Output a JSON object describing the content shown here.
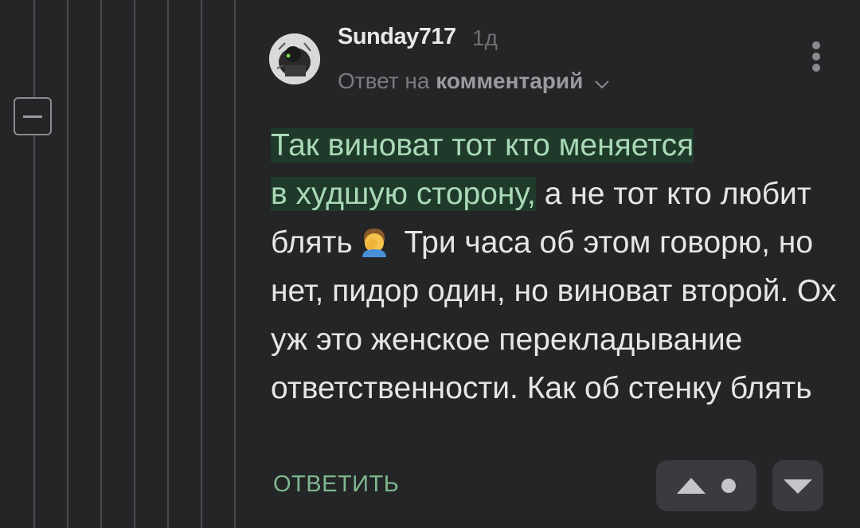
{
  "comment": {
    "author": "Sunday717",
    "time": "1д",
    "reply_prefix": "Ответ на",
    "reply_target": "комментарий",
    "text_highlight_1": "Так виноват тот кто меняется",
    "text_highlight_2": "в худшую сторону,",
    "text_part_1": " а не тот кто любит блять",
    "emoji": "facepalm-emoji",
    "text_part_2": " Три часа об этом говорю, но нет, пидор один, но виноват второй. Ох уж это женское перекладывание ответственности. Как об стенку блять",
    "reply_label": "ОТВЕТИТЬ"
  },
  "icons": {
    "collapse": "minus-icon",
    "menu": "more-vertical-icon",
    "upvote": "triangle-up-icon",
    "downvote": "triangle-down-icon",
    "chevron": "chevron-down-icon"
  },
  "colors": {
    "background": "#242527",
    "highlight_text": "#a9d9b6",
    "highlight_bg": "#1f3a2a",
    "accent_green": "#7fb88f",
    "button_bg": "#3a3b3e"
  }
}
